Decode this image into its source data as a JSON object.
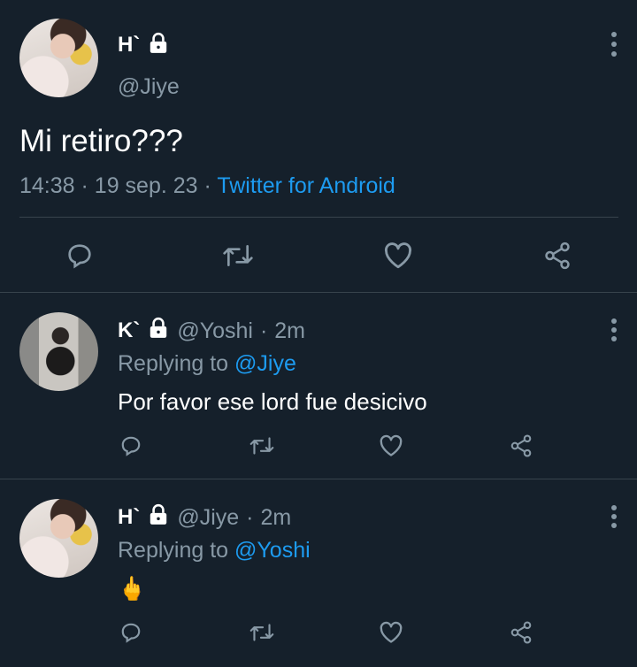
{
  "main_tweet": {
    "display_name": "H`",
    "handle": "@Jiye",
    "text": "Mi retiro???",
    "time": "14:38",
    "date": "19 sep. 23",
    "source": "Twitter for Android",
    "protected": true,
    "icons": [
      "reply-icon",
      "retweet-icon",
      "like-icon",
      "share-icon"
    ]
  },
  "replies": [
    {
      "display_name": "K`",
      "handle": "@Yoshi",
      "age": "2m",
      "replying_prefix": "Replying to",
      "replying_to": "@Jiye",
      "text": "Por favor ese lord fue desicivo",
      "protected": true
    },
    {
      "display_name": "H`",
      "handle": "@Jiye",
      "age": "2m",
      "replying_prefix": "Replying to",
      "replying_to": "@Yoshi",
      "text": "🖕",
      "protected": true
    }
  ],
  "colors": {
    "background": "#15202b",
    "accent": "#1d9bf0",
    "muted": "#8899a6",
    "divider": "#38444d"
  }
}
